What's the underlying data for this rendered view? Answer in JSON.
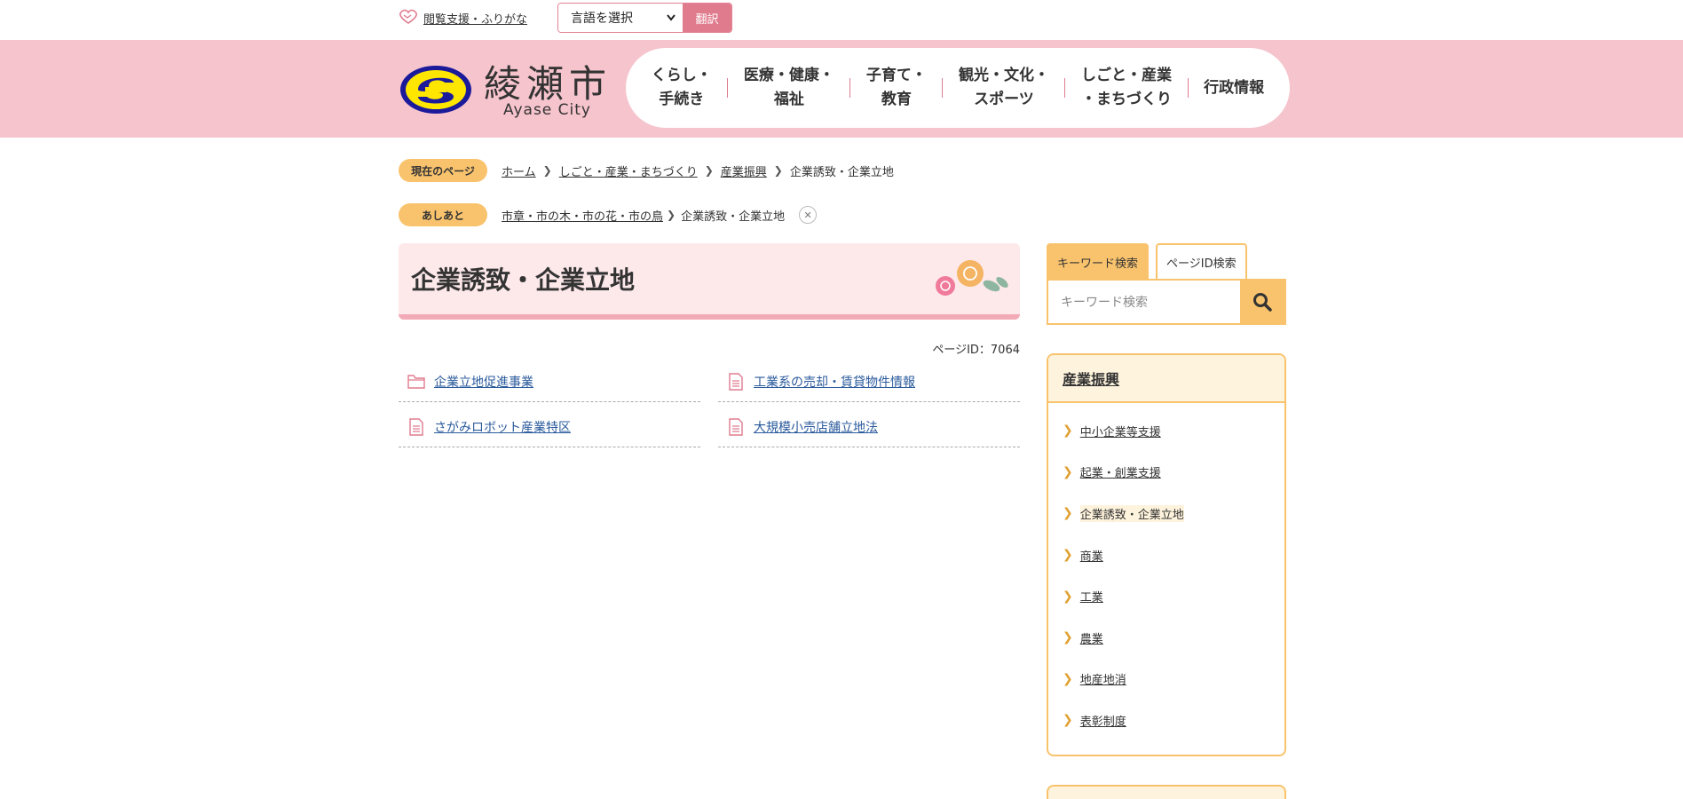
{
  "topbar": {
    "assist_label": "閲覧支援・ふりがな",
    "lang_select_value": "言語を選択",
    "translate_button": "翻訳"
  },
  "header": {
    "city_name": "綾瀬市",
    "city_name_en": "Ayase City",
    "nav": [
      {
        "line1": "くらし・",
        "line2": "手続き"
      },
      {
        "line1": "医療・健康・",
        "line2": "福祉"
      },
      {
        "line1": "子育て・",
        "line2": "教育"
      },
      {
        "line1": "観光・文化・",
        "line2": "スポーツ"
      },
      {
        "line1": "しごと・産業",
        "line2": "・まちづくり"
      },
      {
        "line1": "行政情報",
        "line2": ""
      }
    ]
  },
  "breadcrumb": {
    "label": "現在のページ",
    "items": [
      "ホーム",
      "しごと・産業・まちづくり",
      "産業振興"
    ],
    "current": "企業誘致・企業立地"
  },
  "history": {
    "label": "あしあと",
    "items": [
      "市章・市の木・市の花・市の鳥"
    ],
    "current": "企業誘致・企業立地"
  },
  "main": {
    "title": "企業誘致・企業立地",
    "page_id": "ページID：7064",
    "links": [
      {
        "label": "企業立地促進事業",
        "icon": "folder-icon"
      },
      {
        "label": "工業系の売却・賃貸物件情報",
        "icon": "document-icon"
      },
      {
        "label": "さがみロボット産業特区",
        "icon": "document-icon"
      },
      {
        "label": "大規模小売店舗立地法",
        "icon": "document-icon"
      }
    ]
  },
  "search": {
    "tab_keyword": "キーワード検索",
    "tab_pageid": "ページID検索",
    "placeholder": "キーワード検索"
  },
  "sidebar": {
    "heading": "産業振興",
    "items": [
      {
        "label": "中小企業等支援"
      },
      {
        "label": "起業・創業支援"
      },
      {
        "label": "企業誘致・企業立地"
      },
      {
        "label": "商業"
      },
      {
        "label": "工業"
      },
      {
        "label": "農業"
      },
      {
        "label": "地産地消"
      },
      {
        "label": "表彰制度"
      }
    ]
  },
  "colors": {
    "header_pink": "#f6c4cd",
    "accent_orange": "#f9c36d",
    "translate_button": "#e07b8e",
    "link_blue": "#2a5a9c"
  }
}
